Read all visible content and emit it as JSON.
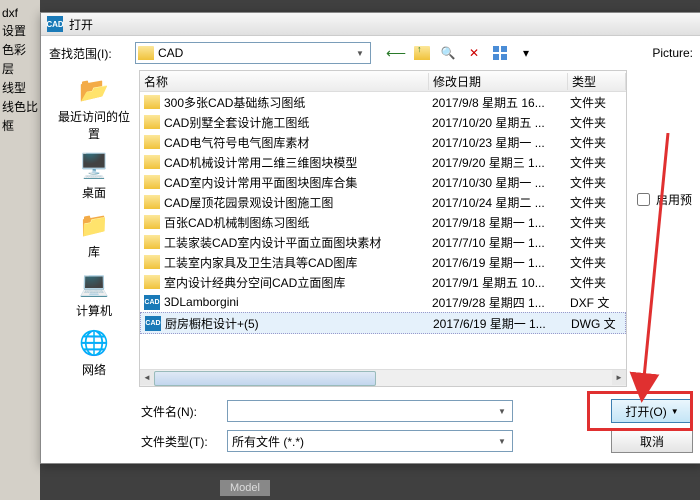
{
  "background": {
    "sidebar_items": [
      "设置",
      "色彩",
      "层",
      "线型",
      "线色比",
      "框"
    ],
    "ext_label": "dxf",
    "tab_model": "Model"
  },
  "dialog": {
    "title": "打开",
    "lookin_label": "查找范围(I):",
    "lookin_value": "CAD",
    "picture_label": "Picture:",
    "enable_checkbox": "启用预",
    "places": [
      {
        "icon": "recent",
        "label": "最近访问的位置"
      },
      {
        "icon": "desktop",
        "label": "桌面"
      },
      {
        "icon": "lib",
        "label": "库"
      },
      {
        "icon": "computer",
        "label": "计算机"
      },
      {
        "icon": "network",
        "label": "网络"
      }
    ],
    "columns": {
      "name": "名称",
      "date": "修改日期",
      "type": "类型"
    },
    "files": [
      {
        "icon": "folder",
        "name": "300多张CAD基础练习图纸",
        "date": "2017/9/8 星期五 16...",
        "type": "文件夹"
      },
      {
        "icon": "folder",
        "name": "CAD别墅全套设计施工图纸",
        "date": "2017/10/20 星期五 ...",
        "type": "文件夹"
      },
      {
        "icon": "folder",
        "name": "CAD电气符号电气图库素材",
        "date": "2017/10/23 星期一 ...",
        "type": "文件夹"
      },
      {
        "icon": "folder",
        "name": "CAD机械设计常用二维三维图块模型",
        "date": "2017/9/20 星期三 1...",
        "type": "文件夹"
      },
      {
        "icon": "folder",
        "name": "CAD室内设计常用平面图块图库合集",
        "date": "2017/10/30 星期一 ...",
        "type": "文件夹"
      },
      {
        "icon": "folder",
        "name": "CAD屋顶花园景观设计图施工图",
        "date": "2017/10/24 星期二 ...",
        "type": "文件夹"
      },
      {
        "icon": "folder",
        "name": "百张CAD机械制图练习图纸",
        "date": "2017/9/18 星期一 1...",
        "type": "文件夹"
      },
      {
        "icon": "folder",
        "name": "工装家装CAD室内设计平面立面图块素材",
        "date": "2017/7/10 星期一 1...",
        "type": "文件夹"
      },
      {
        "icon": "folder",
        "name": "工装室内家具及卫生洁具等CAD图库",
        "date": "2017/6/19 星期一 1...",
        "type": "文件夹"
      },
      {
        "icon": "folder",
        "name": "室内设计经典分空间CAD立面图库",
        "date": "2017/9/1 星期五 10...",
        "type": "文件夹"
      },
      {
        "icon": "cad",
        "name": "3DLamborgini",
        "date": "2017/9/28 星期四 1...",
        "type": "DXF 文"
      },
      {
        "icon": "cad",
        "name": "厨房橱柜设计+(5)",
        "date": "2017/6/19 星期一 1...",
        "type": "DWG 文",
        "selected": true
      }
    ],
    "filename_label": "文件名(N):",
    "filename_value": "",
    "filetype_label": "文件类型(T):",
    "filetype_value": "所有文件 (*.*)",
    "open_button": "打开(O)",
    "cancel_button": "取消"
  },
  "icons": {
    "cad_badge": "CAD"
  }
}
